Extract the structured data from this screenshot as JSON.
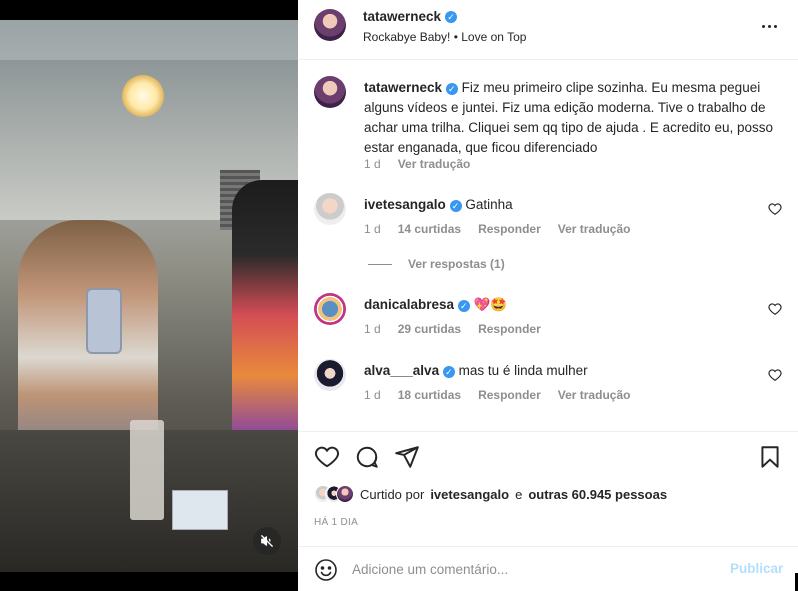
{
  "post": {
    "author": "tatawerneck",
    "audio": "Rockabye Baby! • Love on Top",
    "verified_icon": "✓"
  },
  "caption": {
    "author": "tatawerneck",
    "text": "Fiz meu primeiro clipe sozinha. Eu mesma peguei alguns vídeos e juntei. Fiz uma edição moderna. Tive o trabalho de achar uma trilha. Cliquei sem qq tipo de ajuda . E acredito eu, posso estar enganada, que ficou diferenciado",
    "age": "1 d",
    "translate": "Ver tradução"
  },
  "comments": [
    {
      "user": "ivetesangalo",
      "text": "Gatinha",
      "age": "1 d",
      "likes": "14 curtidas",
      "reply": "Responder",
      "translate": "Ver tradução",
      "view_replies": "Ver respostas (1)"
    },
    {
      "user": "danicalabresa",
      "text": "💖🤩",
      "age": "1 d",
      "likes": "29 curtidas",
      "reply": "Responder"
    },
    {
      "user": "alva___alva",
      "text": "mas tu é linda mulher",
      "age": "1 d",
      "likes": "18 curtidas",
      "reply": "Responder",
      "translate": "Ver tradução"
    }
  ],
  "likes": {
    "prefix": "Curtido por",
    "user": "ivetesangalo",
    "middle": "e",
    "others": "outras 60.945 pessoas"
  },
  "time_ago": "HÁ 1 DIA",
  "add_comment": {
    "placeholder": "Adicione um comentário...",
    "post_label": "Publicar"
  },
  "icons": {
    "more": "more-horizontal-icon",
    "like": "heart-icon",
    "comment": "comment-bubble-icon",
    "share": "paper-plane-icon",
    "save": "bookmark-icon",
    "emoji": "emoji-smile-icon",
    "mute": "speaker-muted-icon"
  },
  "colors": {
    "verified": "#3897f0",
    "muted_text": "#8e8e8e",
    "publish_disabled": "#b2dffc"
  }
}
